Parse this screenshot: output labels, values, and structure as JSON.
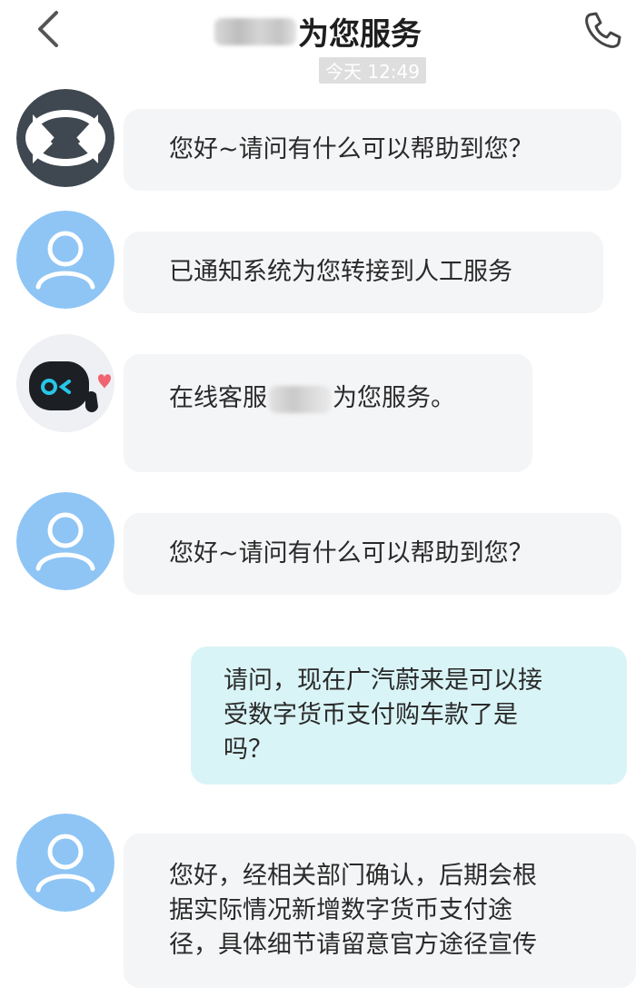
{
  "header": {
    "title": "为您服务",
    "time": "今天 12:49"
  },
  "messages": [
    {
      "side": "in",
      "avatar": "logo-avatar",
      "text": "您好~请问有什么可以帮助到您？"
    },
    {
      "side": "in",
      "avatar": "default-user-avatar",
      "text": "已通知系统为您转接到人工服务"
    },
    {
      "side": "in",
      "avatar": "robot-avatar",
      "prefix": "在线客服",
      "suffix": "为您服务。"
    },
    {
      "side": "in",
      "avatar": "default-user-avatar",
      "text": "您好~请问有什么可以帮助到您？"
    },
    {
      "side": "out",
      "lines": [
        "请问，现在广汽蔚来是可以接",
        "受数字货币支付购车款了是",
        "吗？"
      ]
    },
    {
      "side": "in",
      "avatar": "default-user-avatar",
      "lines": [
        "您好，经相关部门确认，后期会根",
        "据实际情况新增数字货币支付途",
        "径，具体细节请留意官方途径宣传"
      ]
    }
  ],
  "colors": {
    "incoming_bubble": "#f4f5f7",
    "outgoing_bubble": "#d9f4f6",
    "avatar_blue": "#8ec5f5",
    "logo_bg": "#3f4750"
  }
}
